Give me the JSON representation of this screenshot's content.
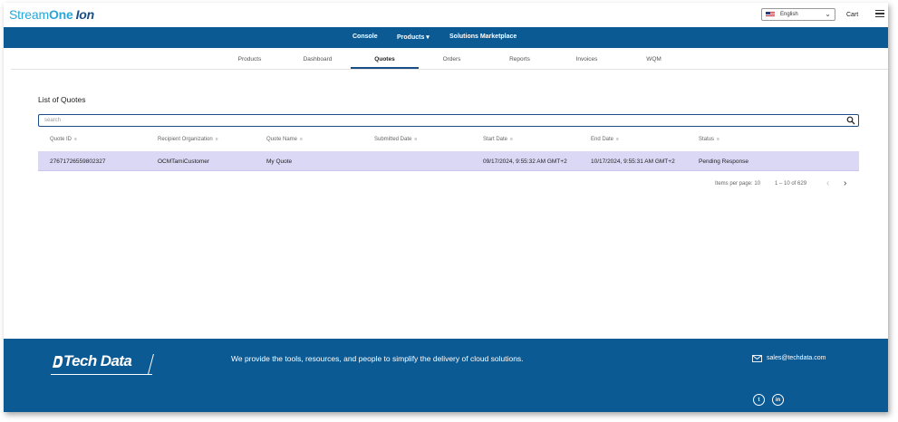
{
  "header": {
    "logo_part1": "Stream",
    "logo_part2": "One",
    "logo_part3": "Ion",
    "language": "English",
    "cart_label": "Cart"
  },
  "main_nav": {
    "console": "Console",
    "products": "Products ▾",
    "marketplace": "Solutions Marketplace"
  },
  "sub_tabs": {
    "items": [
      "Products",
      "Dashboard",
      "Quotes",
      "Orders",
      "Reports",
      "Invoices",
      "WQM"
    ],
    "active": "Quotes"
  },
  "content": {
    "heading": "List of Quotes",
    "search_placeholder": "search",
    "columns": [
      "Quote ID",
      "Recipient Organization",
      "Quote Name",
      "Submitted Date",
      "Start Date",
      "End Date",
      "Status"
    ],
    "rows": [
      {
        "quote_id": "27671726559802327",
        "organization": "OCMTamiCustomer",
        "name": "My Quote",
        "submitted": "",
        "start": "09/17/2024, 9:55:32 AM GMT+2",
        "end": "10/17/2024, 9:55:31 AM GMT+2",
        "status": "Pending Response"
      }
    ]
  },
  "pagination": {
    "items_per_page_label": "Items per page:",
    "items_per_page": "10",
    "range": "1 – 10 of 629",
    "prev": "‹",
    "next": "›"
  },
  "footer": {
    "brand": "Tech Data",
    "tagline": "We provide the tools, resources, and people to simplify the delivery of cloud solutions.",
    "email": "sales@techdata.com",
    "twitter": "t",
    "linkedin": "in"
  },
  "colors": {
    "nav_blue": "#0b5a94",
    "row_highlight": "#dad8f5",
    "accent": "#1a4e86"
  },
  "icons": [
    "chevron-down-icon",
    "menu-icon",
    "search-icon",
    "sort-icon",
    "chevron-left-icon",
    "chevron-right-icon",
    "mail-icon",
    "twitter-icon",
    "linkedin-icon"
  ]
}
